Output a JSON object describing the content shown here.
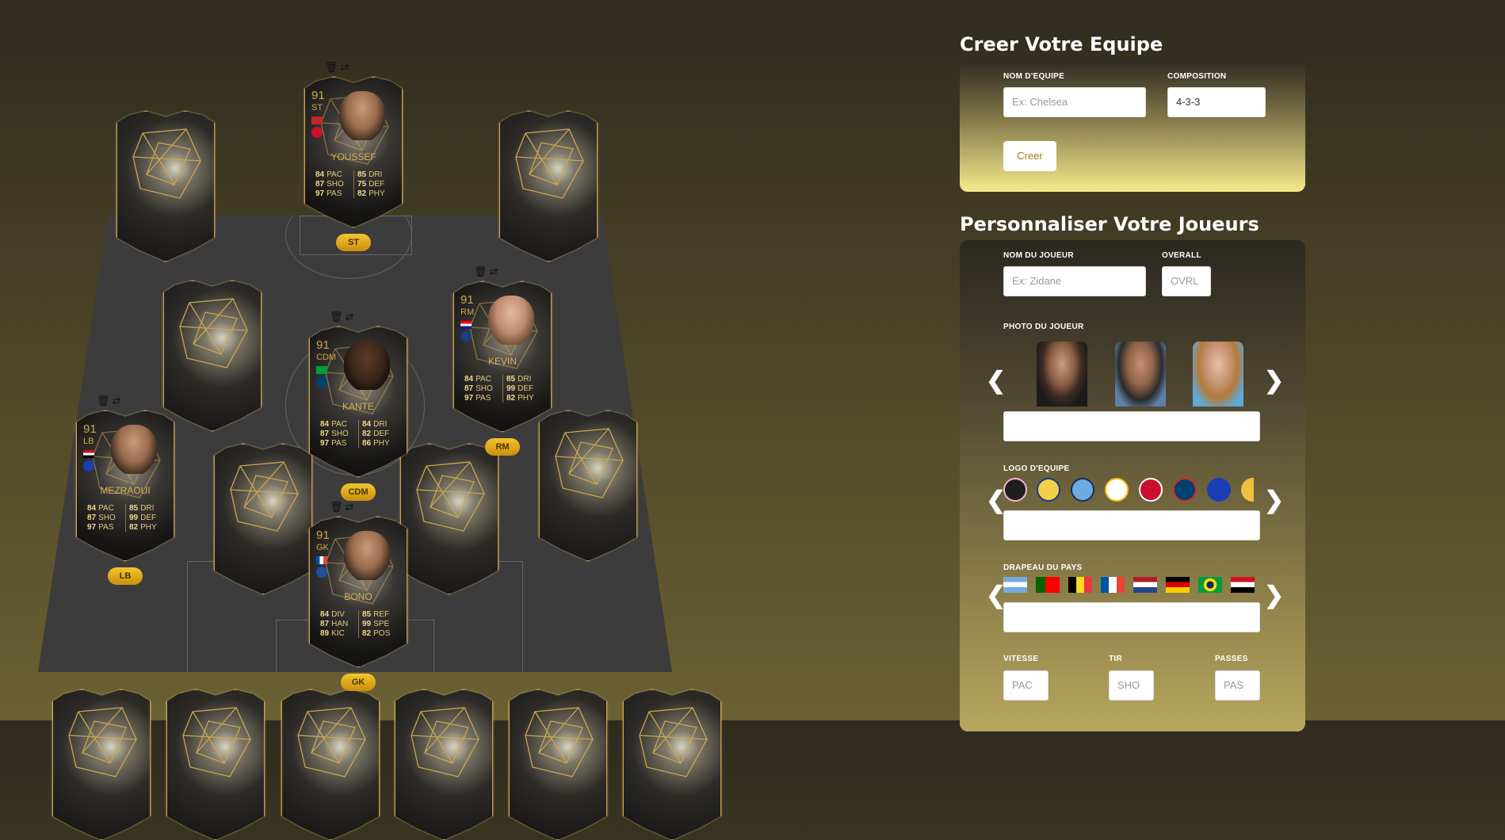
{
  "team": {
    "title": "Creer Votre Equipe",
    "name_label": "NOM D'EQUIPE",
    "name_placeholder": "Ex: Chelsea",
    "composition_label": "COMPOSITION",
    "composition_value": "4-3-3",
    "create_button": "Creer"
  },
  "player_form": {
    "title": "Personnaliser Votre Joueurs",
    "name_label": "NOM DU JOUEUR",
    "name_placeholder": "Ex: Zidane",
    "overall_label": "OVERALL",
    "overall_placeholder": "OVRL",
    "photo_label": "PHOTO DU JOUEUR",
    "logo_label": "LOGO D'EQUIPE",
    "flag_label": "DRAPEAU DU PAYS",
    "speed_label": "VITESSE",
    "speed_placeholder": "PAC",
    "shot_label": "TIR",
    "shot_placeholder": "SHO",
    "pass_label": "PASSES",
    "pass_placeholder": "PAS",
    "prev_arrow": "❮",
    "next_arrow": "❯"
  },
  "cards": [
    {
      "name": "YOUSSEF",
      "ovr": "91",
      "pos": "ST",
      "badge": "ST",
      "stats": [
        [
          "84",
          "PAC"
        ],
        [
          "85",
          "DRI"
        ],
        [
          "87",
          "SHO"
        ],
        [
          "75",
          "DEF"
        ],
        [
          "97",
          "PAS"
        ],
        [
          "82",
          "PHY"
        ]
      ]
    },
    {
      "name": "KEVIN",
      "ovr": "91",
      "pos": "RM",
      "badge": "RM",
      "stats": [
        [
          "84",
          "PAC"
        ],
        [
          "85",
          "DRI"
        ],
        [
          "87",
          "SHO"
        ],
        [
          "99",
          "DEF"
        ],
        [
          "97",
          "PAS"
        ],
        [
          "82",
          "PHY"
        ]
      ]
    },
    {
      "name": "KANTE",
      "ovr": "91",
      "pos": "CDM",
      "badge": "CDM",
      "stats": [
        [
          "84",
          "PAC"
        ],
        [
          "84",
          "DRI"
        ],
        [
          "87",
          "SHO"
        ],
        [
          "82",
          "DEF"
        ],
        [
          "97",
          "PAS"
        ],
        [
          "86",
          "PHY"
        ]
      ]
    },
    {
      "name": "MEZRAOUI",
      "ovr": "91",
      "pos": "LB",
      "badge": "LB",
      "stats": [
        [
          "84",
          "PAC"
        ],
        [
          "85",
          "DRI"
        ],
        [
          "87",
          "SHO"
        ],
        [
          "99",
          "DEF"
        ],
        [
          "97",
          "PAS"
        ],
        [
          "82",
          "PHY"
        ]
      ]
    },
    {
      "name": "BONO",
      "ovr": "91",
      "pos": "GK",
      "badge": "GK",
      "stats": [
        [
          "84",
          "DIV"
        ],
        [
          "85",
          "REF"
        ],
        [
          "87",
          "HAN"
        ],
        [
          "99",
          "SPE"
        ],
        [
          "89",
          "KIC"
        ],
        [
          "82",
          "POS"
        ]
      ]
    }
  ],
  "icons": {
    "delete": "trash-icon",
    "swap": "swap-icon"
  },
  "colors": {
    "gold": "#c9a64e",
    "badge": "#e8b41c",
    "pitch": "#3d3c3c"
  }
}
